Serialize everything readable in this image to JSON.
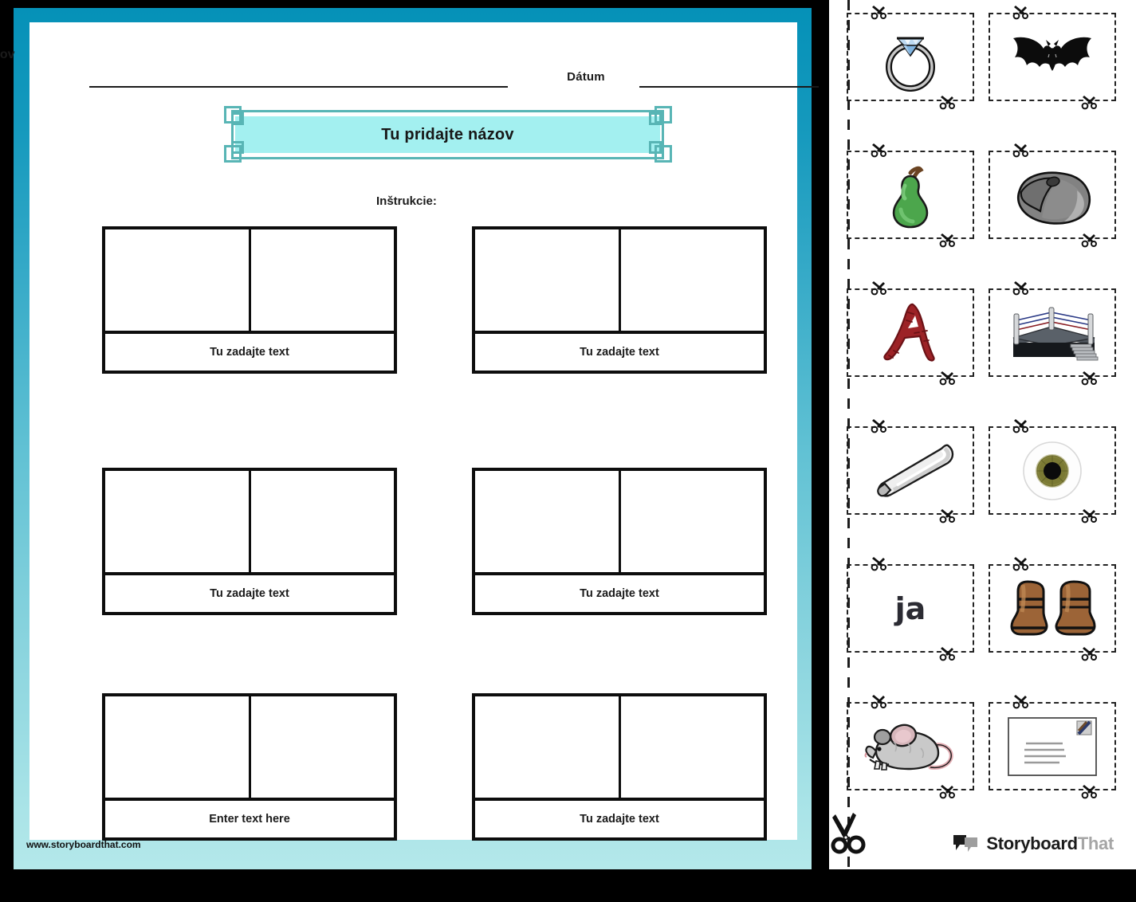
{
  "document": {
    "type": "worksheet",
    "language": "Slovak",
    "name_label_cutoff": "ázov",
    "date_label": "Dátum",
    "title": "Tu pridajte názov",
    "instructions_label": "Inštrukcie:",
    "footer_url": "www.storyboardthat.com"
  },
  "colors": {
    "border_top": "#0591b8",
    "border_bottom": "#b4e8ea",
    "banner_frame": "#58b5b5",
    "banner_fill": "#a3f0f0",
    "ink": "#1b1b1b",
    "box_border": "#0d0d0d"
  },
  "worksheet_boxes": [
    {
      "caption": "Tu zadajte text",
      "cells": 2
    },
    {
      "caption": "Tu zadajte text",
      "cells": 2
    },
    {
      "caption": "Tu zadajte text",
      "cells": 2
    },
    {
      "caption": "Tu zadajte text",
      "cells": 2
    },
    {
      "caption": "Enter text here",
      "cells": 2
    },
    {
      "caption": "Tu zadajte text",
      "cells": 2
    }
  ],
  "cutout_cards": [
    {
      "icon": "diamond-ring-icon",
      "label": "ring",
      "kind": "image"
    },
    {
      "icon": "bat-icon",
      "label": "bat",
      "kind": "image"
    },
    {
      "icon": "pear-icon",
      "label": "pear",
      "kind": "image"
    },
    {
      "icon": "computer-mouse-icon",
      "label": "computer mouse",
      "kind": "image"
    },
    {
      "icon": "letter-a-icon",
      "label": "A",
      "kind": "image"
    },
    {
      "icon": "boxing-ring-icon",
      "label": "boxing ring",
      "kind": "image"
    },
    {
      "icon": "baseball-bat-icon",
      "label": "baseball bat",
      "kind": "image"
    },
    {
      "icon": "eyeball-icon",
      "label": "eye",
      "kind": "image"
    },
    {
      "icon": "word-ja-icon",
      "label": "ja",
      "kind": "text",
      "text": "ja"
    },
    {
      "icon": "boots-icon",
      "label": "boots",
      "kind": "image"
    },
    {
      "icon": "mouse-animal-icon",
      "label": "mouse",
      "kind": "image"
    },
    {
      "icon": "postcard-icon",
      "label": "postcard",
      "kind": "image"
    }
  ],
  "logo": {
    "part1": "Storyboard",
    "part2": "That"
  }
}
